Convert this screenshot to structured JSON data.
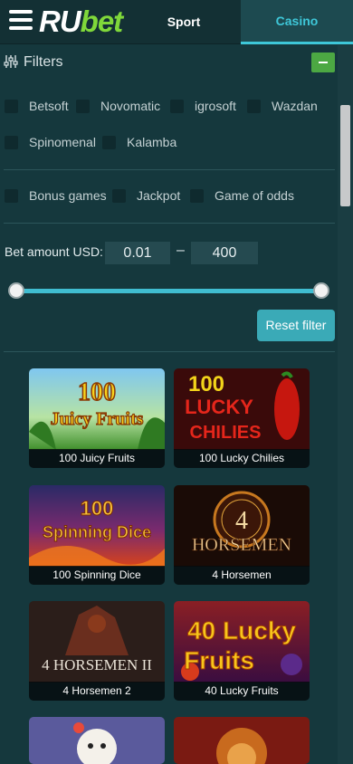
{
  "header": {
    "logo_ru": "RU",
    "logo_bet": "bet",
    "tabs": [
      {
        "label": "Sport",
        "active": false
      },
      {
        "label": "Casino",
        "active": true
      }
    ]
  },
  "filters": {
    "title": "Filters",
    "providers": [
      "Betsoft",
      "Novomatic",
      "igrosoft",
      "Wazdan",
      "Spinomenal",
      "Kalamba"
    ],
    "features": [
      "Bonus games",
      "Jackpot",
      "Game of odds"
    ],
    "bet_amount": {
      "label": "Bet amount USD:",
      "min": "0.01",
      "separator": "–",
      "max": "400"
    },
    "reset_label": "Reset filter"
  },
  "games": [
    {
      "title": "100 Juicy Fruits",
      "art_text": [
        "100",
        "Juicy Fruits"
      ]
    },
    {
      "title": "100 Lucky Chilies",
      "art_text": [
        "100",
        "LUCKY",
        "CHILIES"
      ]
    },
    {
      "title": "100 Spinning Dice",
      "art_text": [
        "100",
        "Spinning Dice"
      ]
    },
    {
      "title": "4 Horsemen",
      "art_text": [
        "4",
        "HORSEMEN"
      ]
    },
    {
      "title": "4 Horsemen 2",
      "art_text": [
        "4 HORSEMEN II"
      ]
    },
    {
      "title": "40 Lucky Fruits",
      "art_text": [
        "40 Lucky",
        "Fruits"
      ]
    }
  ],
  "colors": {
    "background": "#15383d",
    "header": "#133034",
    "accent": "#3ec7d8",
    "logo_green": "#7fd83a",
    "button_green": "#4ca843",
    "reset_button": "#3aaab7"
  }
}
